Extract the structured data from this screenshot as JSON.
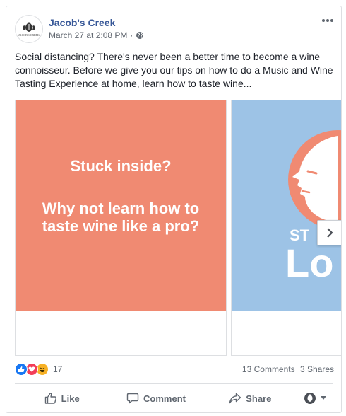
{
  "post": {
    "page_name": "Jacob's Creek",
    "timestamp": "March 27 at 2:08 PM",
    "separator": "·",
    "logo_text": "JACOB'S CREEK",
    "text": "Social distancing? There's never been a better time to become a wine connoisseur. Before we give you our tips on how to do a Music and Wine Tasting Experience at home, learn how to taste wine..."
  },
  "carousel": {
    "slide1": {
      "line1": "Stuck inside?",
      "line2": "Why not learn how to taste wine like a pro?",
      "background": "#f08a72"
    },
    "slide2": {
      "partial_top": "ST",
      "partial_big": "Lo",
      "background": "#9dc3e6"
    }
  },
  "footer": {
    "reaction_count": "17",
    "comments": "13 Comments",
    "shares": "3 Shares"
  },
  "actions": {
    "like": "Like",
    "comment": "Comment",
    "share": "Share"
  },
  "colors": {
    "link": "#385898",
    "like_blue": "#1877f2",
    "love_red": "#f33e58",
    "haha_yellow": "#f7b125"
  },
  "icons": [
    "ellipsis-icon",
    "globe-icon",
    "chevron-right-icon",
    "like-icon",
    "love-icon",
    "haha-icon",
    "thumbs-up-icon",
    "comment-icon",
    "share-icon",
    "dropdown-caret-icon"
  ]
}
